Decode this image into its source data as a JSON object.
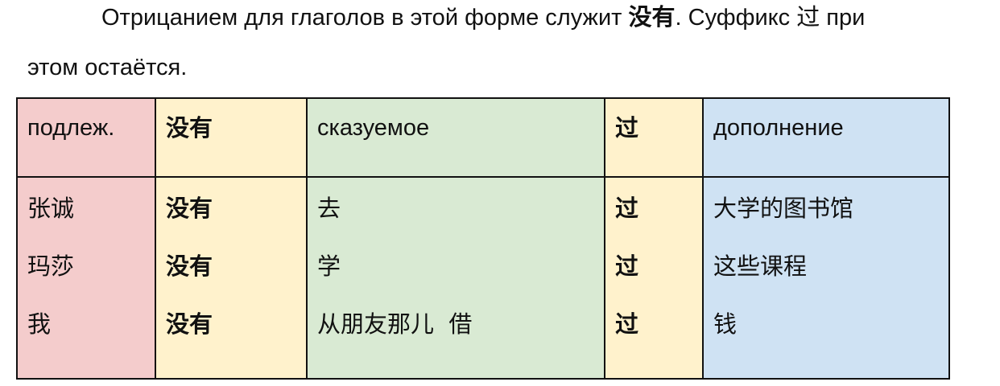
{
  "intro": {
    "line1_before": "Отрицанием для глаголов в этой форме служит ",
    "line1_bold": "没有",
    "line1_after": ". Суффикс 过 при",
    "line2": "этом остаётся."
  },
  "table": {
    "headers": [
      "подлеж.",
      "没有",
      "сказуемое",
      "过",
      "дополнение"
    ],
    "columns": {
      "subject": [
        "张诚",
        "玛莎",
        "我"
      ],
      "negation": [
        "没有",
        "没有",
        "没有"
      ],
      "predicate": [
        "去",
        "学",
        "从朋友那儿  借"
      ],
      "suffix": [
        "过",
        "过",
        "过"
      ],
      "object": [
        "大学的图书馆",
        "这些课程",
        "钱"
      ]
    }
  },
  "colors": {
    "subject_bg": "#f4cccc",
    "negation_bg": "#fff2cc",
    "predicate_bg": "#d9ead3",
    "suffix_bg": "#fff2cc",
    "object_bg": "#cfe2f3",
    "border": "#111111"
  }
}
